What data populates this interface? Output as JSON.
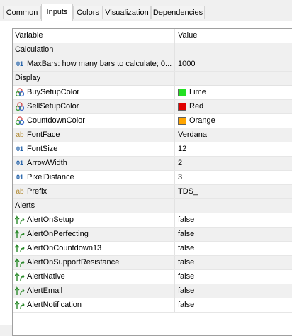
{
  "tabs": [
    "Common",
    "Inputs",
    "Colors",
    "Visualization",
    "Dependencies"
  ],
  "active_tab": "Inputs",
  "columns": {
    "variable": "Variable",
    "value": "Value"
  },
  "sections": {
    "calculation": "Calculation",
    "display": "Display",
    "alerts": "Alerts"
  },
  "rows": {
    "maxbars": {
      "label": "MaxBars: how many bars to calculate; 0...",
      "value": "1000",
      "icon": "number-icon",
      "icon_text": "01"
    },
    "buysetup": {
      "label": "BuySetupColor",
      "value": "Lime",
      "swatch": "#22e022",
      "icon": "palette-icon"
    },
    "sellsetup": {
      "label": "SellSetupColor",
      "value": "Red",
      "swatch": "#e00000",
      "icon": "palette-icon"
    },
    "countdown": {
      "label": "CountdownColor",
      "value": "Orange",
      "swatch": "#ffa500",
      "icon": "palette-icon"
    },
    "fontface": {
      "label": "FontFace",
      "value": "Verdana",
      "icon": "string-icon",
      "icon_text": "ab"
    },
    "fontsize": {
      "label": "FontSize",
      "value": "12",
      "icon": "number-icon",
      "icon_text": "01"
    },
    "arrowwidth": {
      "label": "ArrowWidth",
      "value": "2",
      "icon": "number-icon",
      "icon_text": "01"
    },
    "pixeldist": {
      "label": "PixelDistance",
      "value": "3",
      "icon": "number-icon",
      "icon_text": "01"
    },
    "prefix": {
      "label": "Prefix",
      "value": "TDS_",
      "icon": "string-icon",
      "icon_text": "ab"
    },
    "alertonsetup": {
      "label": "AlertOnSetup",
      "value": "false",
      "icon": "bool-icon"
    },
    "alertonperfecting": {
      "label": "AlertOnPerfecting",
      "value": "false",
      "icon": "bool-icon"
    },
    "alertoncountdown13": {
      "label": "AlertOnCountdown13",
      "value": "false",
      "icon": "bool-icon"
    },
    "alertonsupport": {
      "label": "AlertOnSupportResistance",
      "value": "false",
      "icon": "bool-icon"
    },
    "alertnative": {
      "label": "AlertNative",
      "value": "false",
      "icon": "bool-icon"
    },
    "alertemail": {
      "label": "AlertEmail",
      "value": "false",
      "icon": "bool-icon"
    },
    "alertnotification": {
      "label": "AlertNotification",
      "value": "false",
      "icon": "bool-icon"
    }
  },
  "icon_colors": {
    "number": "#1f5fa8",
    "string": "#b08830",
    "bool": "#2a8a2a"
  }
}
